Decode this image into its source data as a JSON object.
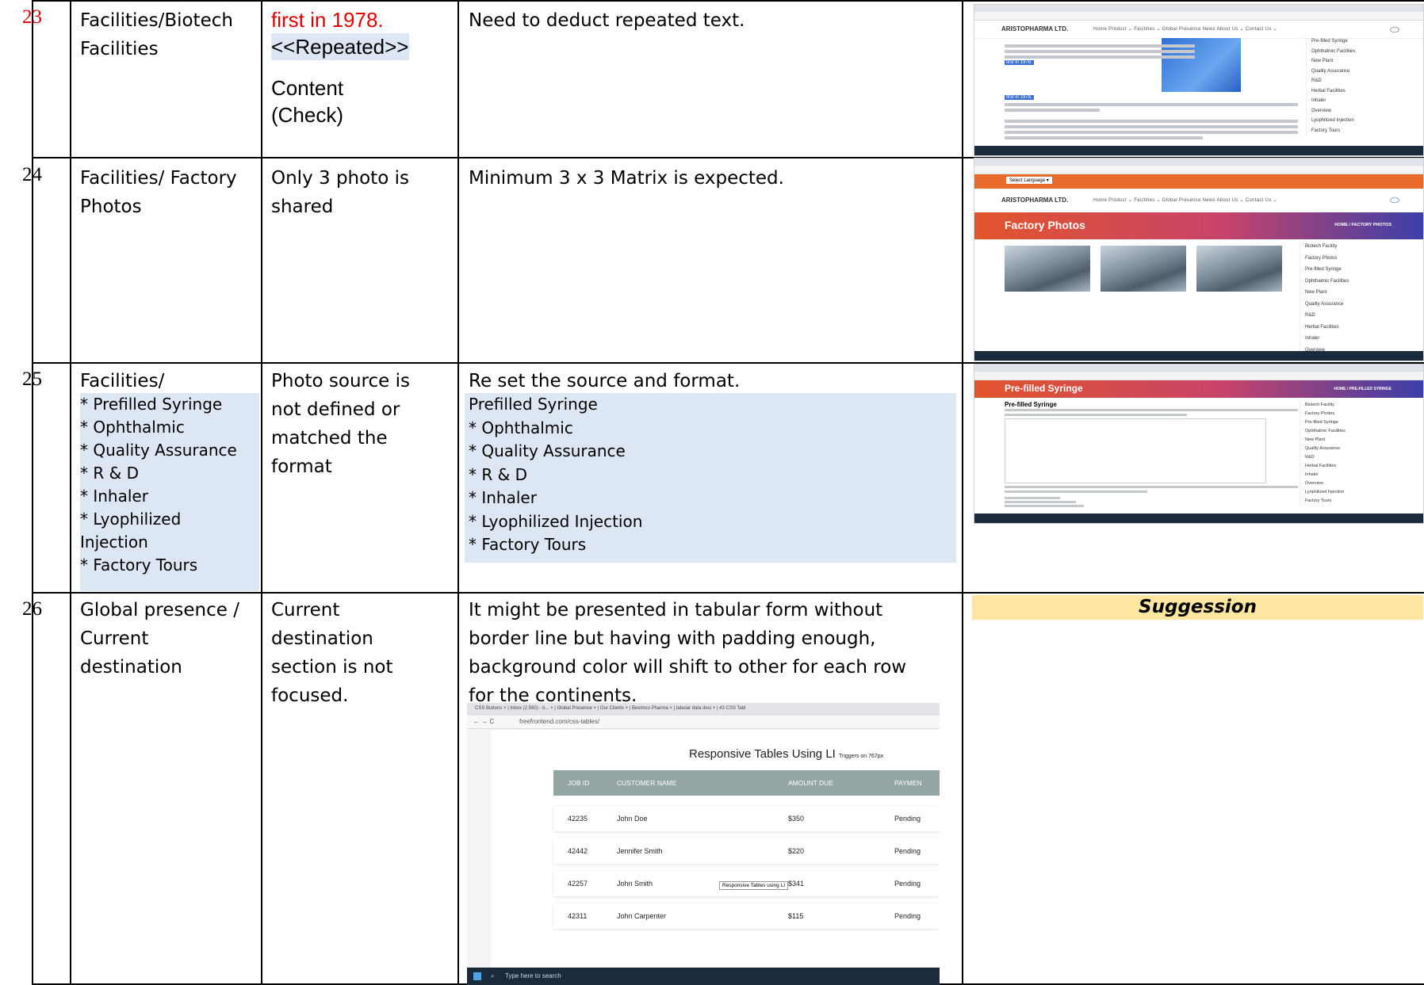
{
  "rows": [
    {
      "number": "23",
      "section_lines": [
        "Facilities/Biotech",
        "Facilities"
      ],
      "issue_lines": [
        "first in 1978.",
        "<<Repeated>>",
        "Content",
        "(Check)"
      ],
      "remark": "Need to deduct repeated text.",
      "thumb": {
        "logo": "ARISTOPHARMA LTD.",
        "nav": "Home   Product ⌄   Facilities ⌄   Global Presence   News   About Us ⌄   Contact Us ⌄",
        "highlight1": "first in 1978.",
        "highlight2": "first in 1978.",
        "menu": [
          "Pre-filled Syringe",
          "Ophthalmic Facilities",
          "New Plant",
          "Quality Assurance",
          "R&D",
          "Herbal Facilities",
          "Inhaler",
          "Overview",
          "Lyophilized Injection",
          "Factory Tours"
        ]
      }
    },
    {
      "number": "24",
      "section_lines": [
        "Facilities/ Factory",
        "Photos"
      ],
      "issue_lines": [
        "Only 3 photo is",
        "shared"
      ],
      "remark": "Minimum 3 x 3 Matrix is expected.",
      "thumb": {
        "language": "Select Language ▾",
        "logo": "ARISTOPHARMA LTD.",
        "nav": "Home   Product ⌄   Facilities ⌄   Global Presence   News   About Us ⌄   Contact Us ⌄",
        "banner": "Factory Photos",
        "crumb": "HOME  /  FACTORY PHOTOS",
        "menu": [
          "Biotech Facility",
          "Factory Photos",
          "Pre-filled Syringe",
          "Ophthalmic Facilities",
          "New Plant",
          "Quality Assurance",
          "R&D",
          "Herbal Facilities",
          "Inhaler",
          "Overview"
        ]
      }
    },
    {
      "number": "25",
      "section_first": "Facilities/",
      "section_items": [
        "* Prefilled Syringe",
        "* Ophthalmic",
        "* Quality Assurance",
        "* R & D",
        "* Inhaler",
        "* Lyophilized",
        "Injection",
        "* Factory Tours"
      ],
      "issue_lines": [
        "Photo source is",
        "not defined or",
        "matched the",
        "format"
      ],
      "remark": "Re set the source and format.",
      "remark_items": [
        "Prefilled Syringe",
        "* Ophthalmic",
        "* Quality Assurance",
        "* R & D",
        "* Inhaler",
        "* Lyophilized Injection",
        "* Factory Tours"
      ],
      "thumb": {
        "banner": "Pre-filled Syringe",
        "crumb": "HOME  /  PRE-FILLED SYRINGE",
        "heading": "Pre-filled Syringe",
        "menu": [
          "Biotech Facility",
          "Factory Photos",
          "Pre-filled Syringe",
          "Ophthalmic Facilities",
          "New Plant",
          "Quality Assurance",
          "R&D",
          "Herbal Facilities",
          "Inhaler",
          "Overview",
          "Lyophilized Injection",
          "Factory Tours"
        ]
      }
    },
    {
      "number": "26",
      "section_lines": [
        "Global presence /",
        "Current",
        "destination"
      ],
      "issue_lines": [
        "Current",
        "destination",
        "section is not",
        "focused."
      ],
      "remark_lines": [
        "It might be presented in tabular form without",
        "border line but having with padding enough,",
        "background color will shift to other for each row",
        "for the continents."
      ],
      "suggestion": "Suggession",
      "table_shot": {
        "tabs": "CSS Buttons  ×  |  Inbox (2,560) - b...  ×  |  Global Presence  ×  |  Our Clients  ×  |  Beximco Pharma  ×  |  tabular data desi  ×  |  43 CSS Tabl",
        "url": "freefrontend.com/css-tables/",
        "title": "Responsive Tables Using LI",
        "title_small": "Triggers on 767px",
        "headers": [
          "JOB ID",
          "CUSTOMER NAME",
          "AMOUNT DUE",
          "PAYMEN"
        ],
        "rows": [
          [
            "42235",
            "John Doe",
            "$350",
            "Pending"
          ],
          [
            "42442",
            "Jennifer Smith",
            "$220",
            "Pending"
          ],
          [
            "42257",
            "John Smith",
            "$341",
            "Pending"
          ],
          [
            "42311",
            "John Carpenter",
            "$115",
            "Pending"
          ]
        ],
        "tooltip": "Responsive Tables using LI",
        "search": "Type here to search"
      }
    }
  ],
  "colors": {
    "red_text": "#e00000",
    "highlight_bg": "#dde7f3",
    "suggestion_bg": "#fde7a0"
  }
}
